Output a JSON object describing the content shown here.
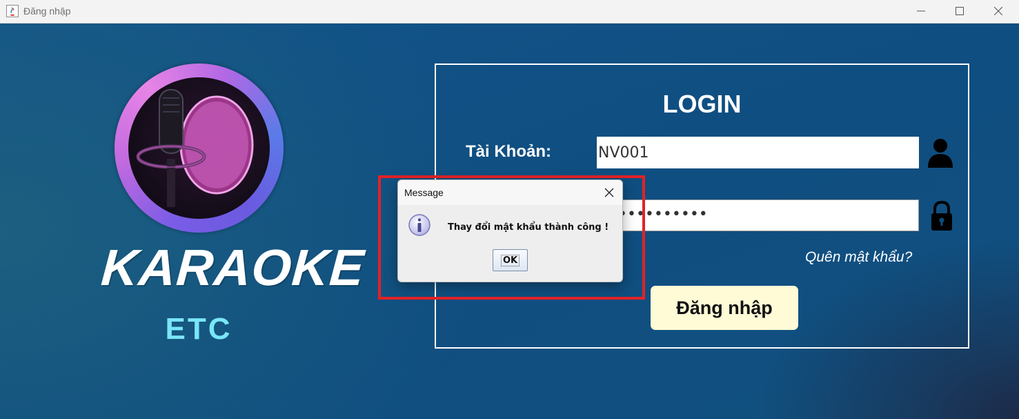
{
  "window": {
    "title": "Đăng nhập",
    "controls": [
      "minimize",
      "maximize",
      "close"
    ]
  },
  "brand": {
    "logo_icon": "microphone-logo",
    "title": "KARAOKE",
    "subtitle": "ETC",
    "colors": {
      "title": "#ffffff",
      "subtitle": "#79e6f7"
    }
  },
  "login": {
    "heading": "LOGIN",
    "account_label": "Tài Khoản:",
    "username_value": "NV001",
    "password_masked": "••••••••••",
    "user_icon": "user-icon",
    "lock_icon": "lock-icon",
    "forgot_password": "Quên mật khẩu?",
    "submit_label": "Đăng nhập"
  },
  "dialog": {
    "title": "Message",
    "icon": "info-icon",
    "message": "Thay đổi mật khẩu thành công !",
    "ok_label": "OK"
  },
  "colors": {
    "background": "#0e4c7e",
    "highlight": "#e32227",
    "button_bg": "#fffbd6"
  }
}
